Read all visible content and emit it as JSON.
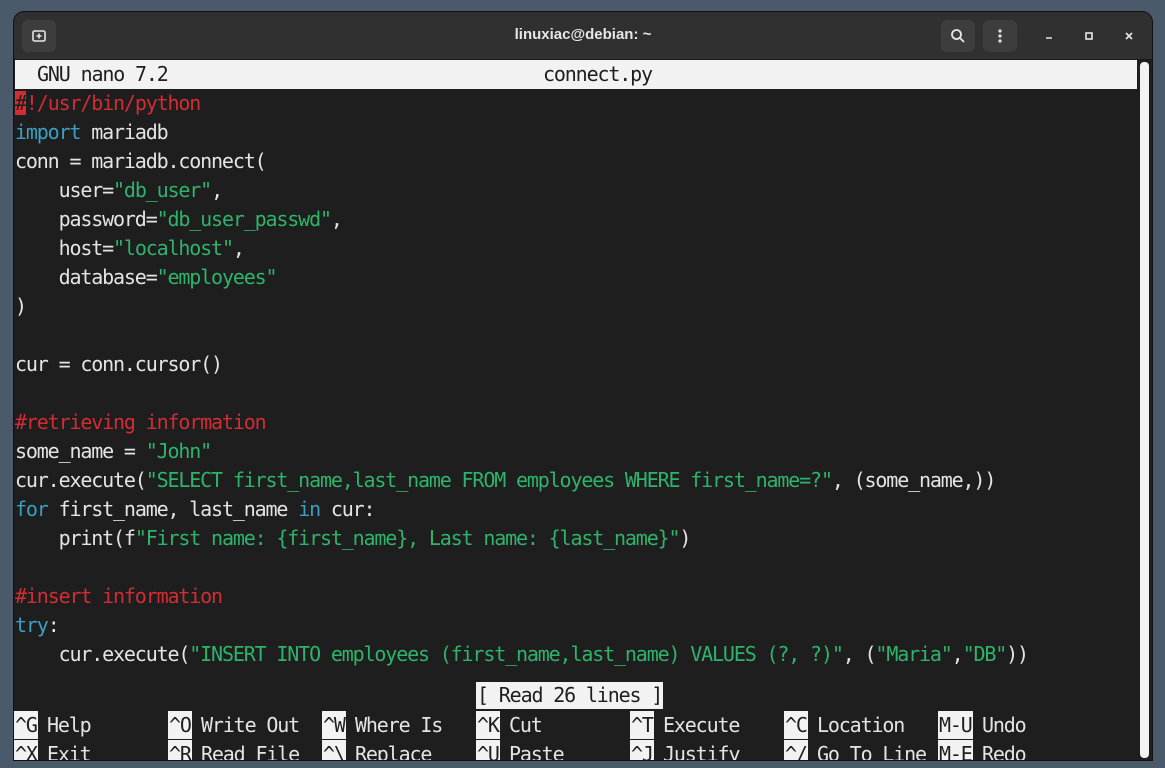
{
  "window": {
    "title": "linuxiac@debian: ~"
  },
  "nano": {
    "version": "GNU nano 7.2",
    "filename": "connect.py",
    "status": "[ Read 26 lines ]"
  },
  "code": {
    "l1_cursor": "#",
    "l1_rest": "!/usr/bin/python",
    "l2_kw": "import",
    "l2_rest": " mariadb",
    "l3": "conn = mariadb.connect(",
    "l4_a": "    user=",
    "l4_s": "\"db_user\"",
    "l4_b": ",",
    "l5_a": "    password=",
    "l5_s": "\"db_user_passwd\"",
    "l5_b": ",",
    "l6_a": "    host=",
    "l6_s": "\"localhost\"",
    "l6_b": ",",
    "l7_a": "    database=",
    "l7_s": "\"employees\"",
    "l8": ")",
    "l10": "cur = conn.cursor()",
    "l12": "#retrieving information",
    "l13_a": "some_name = ",
    "l13_s": "\"John\"",
    "l14_a": "cur.execute(",
    "l14_s": "\"SELECT first_name,last_name FROM employees WHERE first_name=?\"",
    "l14_b": ", (some_name,))",
    "l15_kw1": "for",
    "l15_a": " first_name, last_name ",
    "l15_kw2": "in",
    "l15_b": " cur:",
    "l16_a": "    print(f",
    "l16_s": "\"First name: {first_name}, Last name: {last_name}\"",
    "l16_b": ")",
    "l18": "#insert information",
    "l19_kw": "try",
    "l19_b": ":",
    "l20_a": "    cur.execute(",
    "l20_s1": "\"INSERT INTO employees (first_name,last_name) VALUES (?, ?)\"",
    "l20_b": ", (",
    "l20_s2": "\"Maria\"",
    "l20_c": ",",
    "l20_s3": "\"DB\"",
    "l20_d": "))"
  },
  "shortcuts": [
    {
      "key": "^G",
      "label": "Help"
    },
    {
      "key": "^O",
      "label": "Write Out"
    },
    {
      "key": "^W",
      "label": "Where Is"
    },
    {
      "key": "^K",
      "label": "Cut"
    },
    {
      "key": "^T",
      "label": "Execute"
    },
    {
      "key": "^C",
      "label": "Location"
    },
    {
      "key": "M-U",
      "label": "Undo"
    },
    {
      "key": "^X",
      "label": "Exit"
    },
    {
      "key": "^R",
      "label": "Read File"
    },
    {
      "key": "^\\",
      "label": "Replace"
    },
    {
      "key": "^U",
      "label": "Paste"
    },
    {
      "key": "^J",
      "label": "Justify"
    },
    {
      "key": "^/",
      "label": "Go To Line"
    },
    {
      "key": "M-E",
      "label": "Redo"
    }
  ],
  "icons": {
    "new_tab": "new-tab-icon",
    "search": "search-icon",
    "menu": "kebab-menu-icon",
    "minimize": "minimize-icon",
    "maximize": "maximize-icon",
    "close": "close-icon"
  }
}
